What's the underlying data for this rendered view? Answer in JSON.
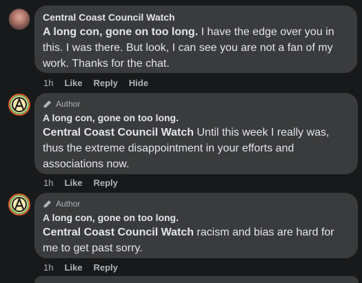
{
  "comments": [
    {
      "author": "Central Coast Council Watch",
      "mention": "A long con, gone on too long.",
      "text": " I have the edge over you in this. I was there. But look, I can see you are not a fan of my work. Thanks for the chat.",
      "time": "1h",
      "like": "Like",
      "reply": "Reply",
      "hide": "Hide"
    },
    {
      "author_tag": "Author",
      "author": "A long con, gone on too long.",
      "mention": "Central Coast Council Watch",
      "text": " Until this week I really was, thus the extreme disappointment in your efforts and associations now.",
      "time": "1h",
      "like": "Like",
      "reply": "Reply"
    },
    {
      "author_tag": "Author",
      "author": "A long con, gone on too long.",
      "mention": "Central Coast Council Watch",
      "text": " racism and bias are hard for me to get past sorry.",
      "time": "1h",
      "like": "Like",
      "reply": "Reply"
    }
  ],
  "colors": {
    "background": "#18191a",
    "bubble": "#3a3b3c",
    "primary_text": "#e4e6eb",
    "secondary_text": "#b0b3b8"
  }
}
